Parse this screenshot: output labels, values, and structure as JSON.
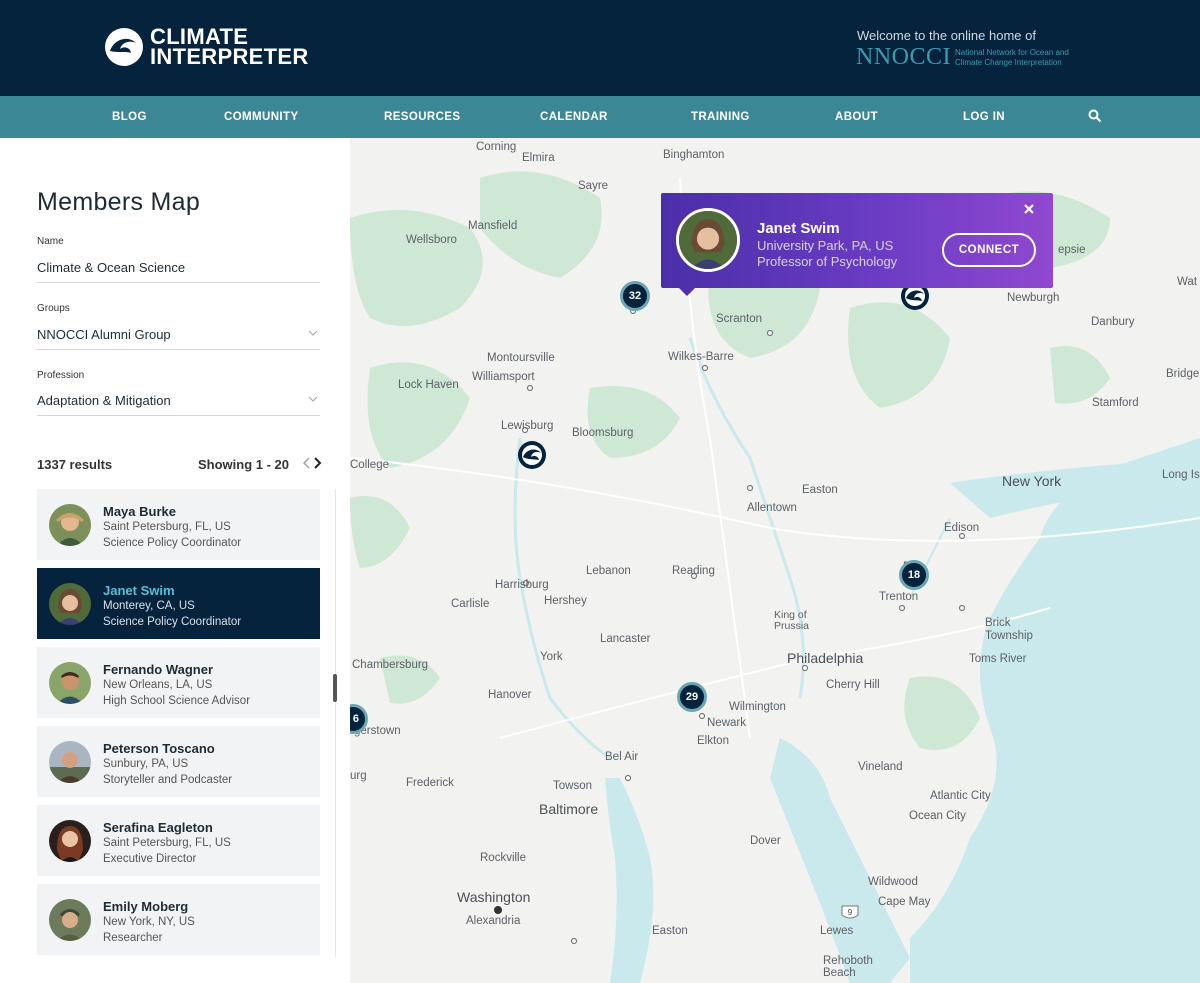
{
  "header": {
    "logo_line1": "CLIMATE",
    "logo_line2": "INTERPRETER",
    "welcome": "Welcome to the online home of",
    "nnocci": "NNOCCI",
    "nnocci_sub": "National Network for Ocean and Climate Change Interpretation"
  },
  "nav": {
    "items": [
      "BLOG",
      "COMMUNITY",
      "RESOURCES",
      "CALENDAR",
      "TRAINING",
      "ABOUT",
      "LOG IN"
    ],
    "search_icon": "search-icon"
  },
  "sidebar": {
    "title": "Members Map",
    "filters": {
      "name_label": "Name",
      "name_value": "Climate & Ocean Science",
      "groups_label": "Groups",
      "groups_value": "NNOCCI Alumni Group",
      "profession_label": "Profession",
      "profession_value": "Adaptation & Mitigation"
    },
    "results": "1337 results",
    "showing": "Showing 1 - 20",
    "members": [
      {
        "name": "Maya Burke",
        "location": "Saint Petersburg, FL, US",
        "role": "Science Policy Coordinator"
      },
      {
        "name": "Janet Swim",
        "location": "Monterey, CA, US",
        "role": "Science Policy Coordinator"
      },
      {
        "name": "Fernando Wagner",
        "location": "New Orleans, LA, US",
        "role": "High School Science Advisor"
      },
      {
        "name": "Peterson Toscano",
        "location": "Sunbury, PA, US",
        "role": "Storyteller and Podcaster"
      },
      {
        "name": "Serafina Eagleton",
        "location": "Saint Petersburg, FL, US",
        "role": "Executive Director"
      },
      {
        "name": "Emily Moberg",
        "location": "New York, NY, US",
        "role": "Researcher"
      }
    ]
  },
  "map": {
    "places": [
      "Corning",
      "Elmira",
      "Binghamton",
      "Sayre",
      "Mansfield",
      "Wellsboro",
      "Scranton",
      "Newburgh",
      "Danbury",
      "Wilkes-Barre",
      "Montoursville",
      "Williamsport",
      "Lock Haven",
      "Lewisburg",
      "Bloomsburg",
      "College",
      "Easton",
      "Allentown",
      "New York",
      "Edison",
      "Stamford",
      "Bridgeport",
      "Long Isl",
      "Harrisburg",
      "Lebanon",
      "Reading",
      "Carlisle",
      "Hershey",
      "Trenton",
      "King of Prussia",
      "Brick Township",
      "Lancaster",
      "Philadelphia",
      "Cherry Hill",
      "Toms River",
      "Chambersburg",
      "York",
      "Hanover",
      "Wilmington",
      "Newark",
      "Elkton",
      "gerstown",
      "Bel Air",
      "Frederick",
      "Towson",
      "Baltimore",
      "Vineland",
      "Atlantic City",
      "Ocean City",
      "Dover",
      "Rockville",
      "Washington",
      "Alexandria",
      "Wildwood",
      "Cape May",
      "Easton",
      "Lewes",
      "Rehoboth Beach",
      "epsie",
      "Wat",
      "urg",
      "Fr"
    ],
    "clusters": [
      "32",
      "18",
      "29",
      "6"
    ],
    "popup": {
      "name": "Janet Swim",
      "location": "University Park, PA, US",
      "role": "Professor of Psychology",
      "connect_label": "CONNECT"
    },
    "highway_shield": "9"
  },
  "colors": {
    "header_bg": "#05233d",
    "nav_bg": "#3b8796",
    "active_row": "#05233d",
    "active_name": "#5bc0d6",
    "popup_start": "#4a2fa8",
    "popup_end": "#9048d0",
    "water": "#c9e9ec",
    "park": "#cfe8d6"
  }
}
